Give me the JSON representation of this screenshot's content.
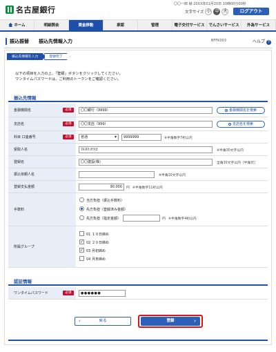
{
  "header": {
    "bank_name": "名古屋銀行",
    "user_line": "〇〇一郎 様  20XX年01月20日 10時00分00秒",
    "font_size_label": "文字サイズ",
    "font_sizes": [
      "小",
      "中",
      "大"
    ],
    "logout": "ログアウト"
  },
  "nav": {
    "items": [
      "ホーム",
      "明細照会",
      "資金移動",
      "承認",
      "管理",
      "電子交付サービス",
      "でんさいサービス",
      "外為サービス"
    ],
    "active_index": 2
  },
  "title": {
    "main": "振込振替",
    "sub": "振込先情報入力",
    "screen_id": "BFFK003",
    "help": "ヘルプ"
  },
  "steps": [
    "振込先情報を入力",
    "登録完了"
  ],
  "intro": {
    "line1": "以下の項目を入力の上、「登録」ボタンをクリックしてください。",
    "line2": "ワンタイムパスワードは、ご利用のトークンをご確認ください。"
  },
  "section_payee": "振込先情報",
  "section_auth": "認証情報",
  "required": "必須",
  "fields": {
    "bank": {
      "label": "金融機関名",
      "value": "〇〇銀行（9999）",
      "button": "金融機関名を検索"
    },
    "branch": {
      "label": "支店名",
      "value": "〇〇支店（999）",
      "button": "支店名を検索"
    },
    "account": {
      "label": "科目 口座番号",
      "type": "普通",
      "number": "9999999",
      "hint": "※半角数字7桁以内"
    },
    "payee_kana": {
      "label": "受取人名",
      "value": "ﾏﾙﾏﾙｹﾝｾﾂ(ｶ",
      "hint": "※半角30文字以内"
    },
    "registered_name": {
      "label": "登録名",
      "value": "〇〇建設(株)",
      "hint": "全角30文字以内［半角可］"
    },
    "requester_name": {
      "label": "振込依頼人名",
      "value": "",
      "hint": "※半角20文字以内"
    },
    "amount": {
      "label": "登録支払金額",
      "value": "90,000",
      "unit": "円",
      "hint": "※半角数字11桁以内"
    },
    "fee": {
      "label": "手数料",
      "options": [
        "当方負担（振込手数料）",
        "先方負担（登録済み金額）",
        "先方負担（指定金額）"
      ],
      "selected_index": 1,
      "unit": "円",
      "hint": "※半角数字4桁以内"
    },
    "group": {
      "label": "所属グループ",
      "items": [
        "01 １０日締め",
        "02 ２０日締め",
        "03 月初締め",
        "04 月末締め"
      ],
      "checked": [
        false,
        true,
        true,
        false
      ]
    },
    "otp": {
      "label": "ワンタイムパスワード",
      "value": "●●●●●●"
    }
  },
  "buttons": {
    "back": "戻る",
    "submit": "登録"
  }
}
